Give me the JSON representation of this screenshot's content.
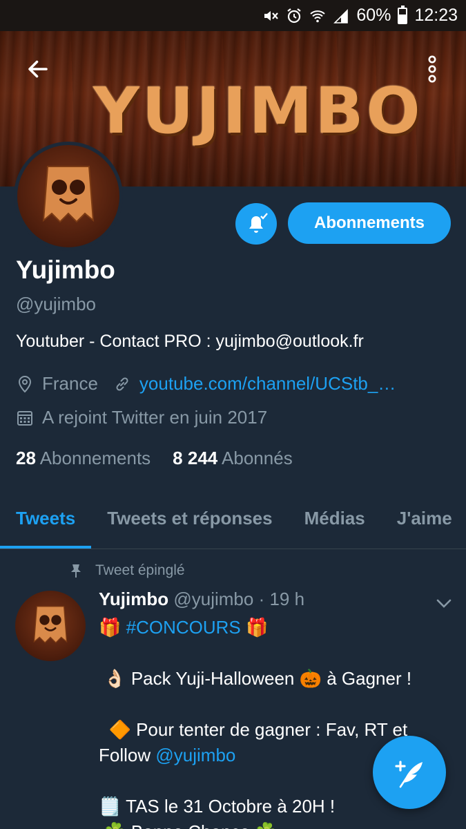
{
  "status_bar": {
    "battery_percent": "60%",
    "battery_level": 0.6,
    "time": "12:23",
    "icons": [
      "mute-icon",
      "alarm-icon",
      "wifi-icon",
      "signal-icon"
    ]
  },
  "banner": {
    "logo_text": "YUJIMBO",
    "colors": {
      "wood_dark": "#4a1c0c",
      "logo": "#e8a05a"
    }
  },
  "header": {
    "back_icon": "arrow-left-icon",
    "more_icon": "more-vertical-icon"
  },
  "profile": {
    "display_name": "Yujimbo",
    "handle": "@yujimbo",
    "bio": "Youtuber - Contact PRO : yujimbo@outlook.fr",
    "location": "France",
    "website": "youtube.com/channel/UCStb_…",
    "joined": "A rejoint Twitter en juin 2017",
    "following_count": "28",
    "following_label": "Abonnements",
    "followers_count": "8 244",
    "followers_label": "Abonnés",
    "notify_icon": "bell-check-icon",
    "follow_button": "Abonnements"
  },
  "tabs": [
    {
      "label": "Tweets",
      "active": true
    },
    {
      "label": "Tweets et réponses",
      "active": false
    },
    {
      "label": "Médias",
      "active": false
    },
    {
      "label": "J'aime",
      "active": false
    }
  ],
  "tweet": {
    "pinned_label": "Tweet épinglé",
    "author_name": "Yujimbo",
    "author_handle": "@yujimbo",
    "time": "· 19 h",
    "hashtag": "#CONCOURS",
    "line_pack_pre": "Pack Yuji-Halloween",
    "line_pack_post": "à Gagner !",
    "line_rules": "Pour tenter de gagner : Fav, RT et",
    "line_follow_pre": "Follow",
    "line_follow_mention": "@yujimbo",
    "line_tas": "TAS le 31 Octobre à 20H !",
    "line_luck": "Bonne Chance"
  },
  "colors": {
    "background": "#1c2938",
    "accent": "#1da1f2",
    "muted": "#8899a6"
  }
}
